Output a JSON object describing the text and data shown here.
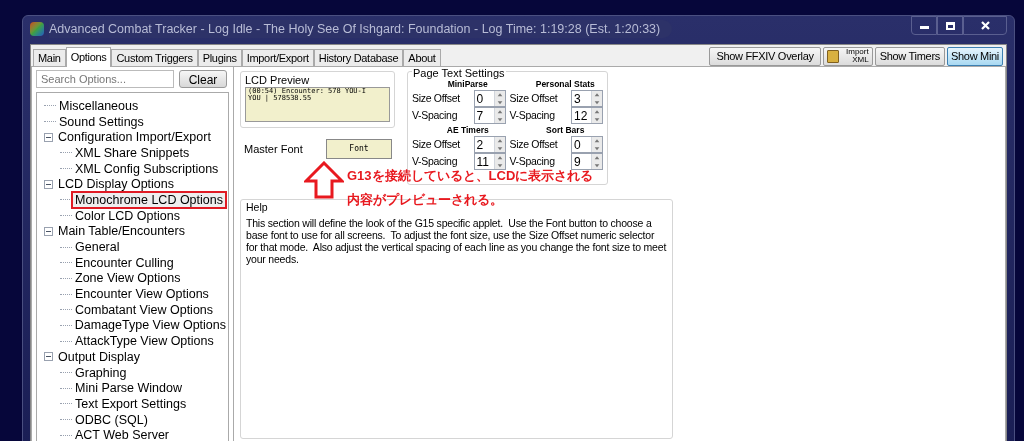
{
  "window": {
    "title": "Advanced Combat Tracker - Log Idle - The Holy See Of Ishgard: Foundation - Log Time: 1:19:28 (Est. 1:20:33)"
  },
  "tabs": [
    {
      "label": "Main",
      "selected": false
    },
    {
      "label": "Options",
      "selected": true
    },
    {
      "label": "Custom Triggers",
      "selected": false
    },
    {
      "label": "Plugins",
      "selected": false
    },
    {
      "label": "Import/Export",
      "selected": false
    },
    {
      "label": "History Database",
      "selected": false
    },
    {
      "label": "About",
      "selected": false
    }
  ],
  "toolbar": {
    "overlay_button": "Show FFXIV Overlay",
    "import_button": "Import XML",
    "timers_button": "Show Timers",
    "mini_button": {
      "label": "Show Mini",
      "selected": true
    }
  },
  "search": {
    "placeholder": "Search Options...",
    "clear_button": "Clear"
  },
  "tree": [
    {
      "label": "Miscellaneous",
      "selected": false
    },
    {
      "label": "Sound Settings",
      "selected": false
    },
    {
      "label": "Configuration Import/Export",
      "selected": false,
      "expanded": true,
      "children": [
        {
          "label": "XML Share Snippets",
          "selected": false
        },
        {
          "label": "XML Config Subscriptions",
          "selected": false
        }
      ]
    },
    {
      "label": "LCD Display Options",
      "selected": false,
      "expanded": true,
      "children": [
        {
          "label": "Monochrome LCD Options",
          "selected": true
        },
        {
          "label": "Color LCD Options",
          "selected": false
        }
      ]
    },
    {
      "label": "Main Table/Encounters",
      "selected": false,
      "expanded": true,
      "children": [
        {
          "label": "General",
          "selected": false
        },
        {
          "label": "Encounter Culling",
          "selected": false
        },
        {
          "label": "Zone View Options",
          "selected": false
        },
        {
          "label": "Encounter View Options",
          "selected": false
        },
        {
          "label": "Combatant View Options",
          "selected": false
        },
        {
          "label": "DamageType View Options",
          "selected": false
        },
        {
          "label": "AttackType View Options",
          "selected": false
        }
      ]
    },
    {
      "label": "Output Display",
      "selected": false,
      "expanded": true,
      "children": [
        {
          "label": "Graphing",
          "selected": false
        },
        {
          "label": "Mini Parse Window",
          "selected": false
        },
        {
          "label": "Text Export Settings",
          "selected": false
        },
        {
          "label": "ODBC (SQL)",
          "selected": false
        },
        {
          "label": "ACT Web Server",
          "selected": false
        }
      ]
    }
  ],
  "lcd_preview": {
    "title": "LCD Preview",
    "lines": [
      "(00:54) Encounter: 578 YOU-I",
      "YOU | 578538.55"
    ]
  },
  "master_font": {
    "label": "Master Font",
    "button": "Font"
  },
  "page_text_settings": {
    "title": "Page Text Settings",
    "groups": [
      {
        "title": "MiniParse",
        "rows": [
          {
            "label": "Size Offset",
            "value": "0"
          },
          {
            "label": "V-Spacing",
            "value": "7"
          }
        ]
      },
      {
        "title": "Personal Stats",
        "rows": [
          {
            "label": "Size Offset",
            "value": "3"
          },
          {
            "label": "V-Spacing",
            "value": "12"
          }
        ]
      },
      {
        "title": "AE Timers",
        "rows": [
          {
            "label": "Size Offset",
            "value": "2"
          },
          {
            "label": "V-Spacing",
            "value": "11"
          }
        ]
      },
      {
        "title": "Sort Bars",
        "rows": [
          {
            "label": "Size Offset",
            "value": "0"
          },
          {
            "label": "V-Spacing",
            "value": "9"
          }
        ]
      }
    ]
  },
  "annotation": {
    "text": "G13を接続していると、LCDに表示される内容がプレビューされる。"
  },
  "help": {
    "title": "Help",
    "text": "This section will define the look of the G15 specific applet.  Use the Font button to choose a base font to use for all screens.  To adjust the font size, use the Size Offset numeric selector for that mode.  Also adjust the vertical spacing of each line as you change the font size to meet your needs."
  }
}
